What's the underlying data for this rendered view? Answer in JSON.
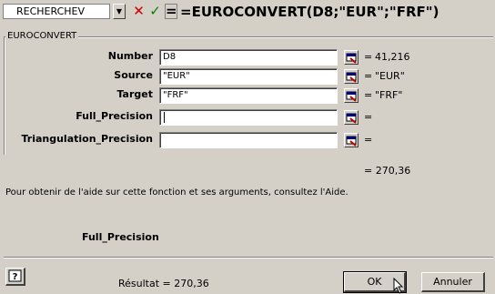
{
  "formula_bar": {
    "name_box": "RECHERCHEV",
    "cancel_glyph": "✕",
    "enter_glyph": "✓",
    "equals_glyph": "=",
    "formula": "=EUROCONVERT(D8;\"EUR\";\"FRF\")"
  },
  "dialog": {
    "group_label": "EUROCONVERT",
    "arguments": [
      {
        "label": "Number",
        "value": "D8",
        "equals": "=",
        "result": "41,216"
      },
      {
        "label": "Source",
        "value": "\"EUR\"",
        "equals": "=",
        "result": "\"EUR\""
      },
      {
        "label": "Target",
        "value": "\"FRF\"",
        "equals": "=",
        "result": "\"FRF\""
      },
      {
        "label": "Full_Precision",
        "value": "",
        "equals": "=",
        "result": ""
      },
      {
        "label": "Triangulation_Precision",
        "value": "",
        "equals": "=",
        "result": ""
      }
    ],
    "formula_result": "= 270,36",
    "help_text": "Pour obtenir de l'aide sur cette fonction et ses arguments, consultez l'Aide.",
    "current_argument": "Full_Precision",
    "result_line": "Résultat = 270,36",
    "help_button_glyph": "?",
    "ok_label": "OK",
    "cancel_label": "Annuler"
  },
  "colors": {
    "dialog_bg": "#d4d0c8",
    "cancel_red": "#cc0000",
    "enter_green": "#008000"
  }
}
